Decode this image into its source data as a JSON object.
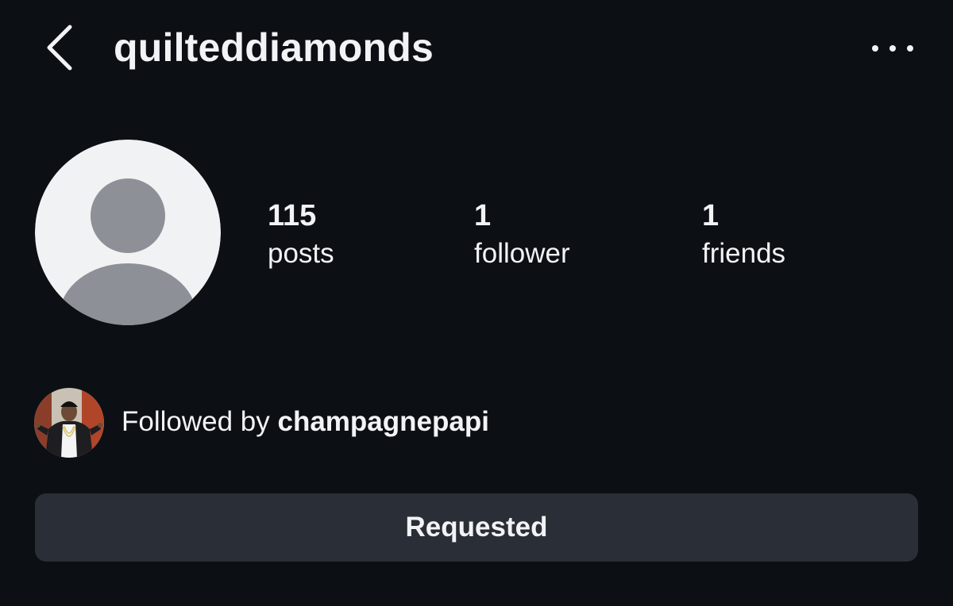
{
  "header": {
    "username": "quilteddiamonds",
    "back_icon": "chevron-left-icon",
    "more_icon": "more-horizontal-icon"
  },
  "profile": {
    "avatar_icon": "default-avatar-icon",
    "stats": {
      "posts": {
        "value": "115",
        "label": "posts"
      },
      "followers": {
        "value": "1",
        "label": "follower"
      },
      "friends": {
        "value": "1",
        "label": "friends"
      }
    }
  },
  "followed_by": {
    "prefix": "Followed by ",
    "name": "champagnepapi"
  },
  "action": {
    "label": "Requested"
  },
  "colors": {
    "background": "#0c0f14",
    "text": "#f2f3f5",
    "button_bg": "#2a2e36",
    "avatar_bg": "#f1f2f4",
    "avatar_silhouette": "#8e9097"
  }
}
